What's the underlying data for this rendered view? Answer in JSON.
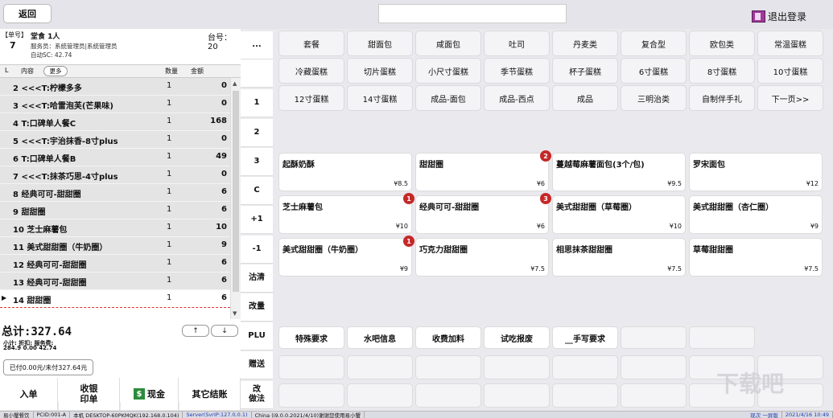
{
  "topbar": {
    "back_label": "返回",
    "logout_label": "退出登录"
  },
  "order": {
    "bill_label": "【单号】",
    "bill_no": "7",
    "dine_label": "堂食 1人",
    "staff": "服务员：系统管理员|系统管理员",
    "auto_sc": "自动SC: 42.74",
    "table_label": "台号： 20",
    "columns": {
      "idx": "L",
      "content": "内容",
      "more": "更多",
      "qty": "数量",
      "amount": "金额"
    },
    "items": [
      {
        "name": "2 <<<T:柠檬多多",
        "qty": "1",
        "amt": "0"
      },
      {
        "name": "3 <<<T:哈雷泡芙(芒果味)",
        "qty": "1",
        "amt": "0"
      },
      {
        "name": "4 T:口碑单人餐C",
        "qty": "1",
        "amt": "168"
      },
      {
        "name": "5 <<<T:宇治抹香-8寸plus",
        "qty": "1",
        "amt": "0"
      },
      {
        "name": "6 T:口碑单人餐B",
        "qty": "1",
        "amt": "49"
      },
      {
        "name": "7 <<<T:抹茶巧思-4寸plus",
        "qty": "1",
        "amt": "0"
      },
      {
        "name": "8 经典可可-甜甜圈",
        "qty": "1",
        "amt": "6"
      },
      {
        "name": "9 甜甜圈",
        "qty": "1",
        "amt": "6"
      },
      {
        "name": "10 芝士麻薯包",
        "qty": "1",
        "amt": "10"
      },
      {
        "name": "11 美式甜甜圈（牛奶圈）",
        "qty": "1",
        "amt": "9"
      },
      {
        "name": "12 经典可可-甜甜圈",
        "qty": "1",
        "amt": "6"
      },
      {
        "name": "13 经典可可-甜甜圈",
        "qty": "1",
        "amt": "6"
      },
      {
        "name": "14 甜甜圈",
        "qty": "1",
        "amt": "6"
      }
    ],
    "total": "总计:327.64",
    "up_arrow": "↑",
    "down_arrow": "↓",
    "sub_labels": "小计: 折扣: 服务费:",
    "sub_values": "284.9 0.00 42.74",
    "paid": "已付0.00元/未付327.64元",
    "buttons": {
      "enter": "入单",
      "receipt": "收银\n印单",
      "cash": "现金",
      "other": "其它结账"
    },
    "cash_icon": "dollar-icon"
  },
  "keypad": [
    "...",
    "",
    "1",
    "2",
    "3",
    "C",
    "+1",
    "-1",
    "沽清",
    "改量",
    "PLU",
    "赠送",
    "改\n做法"
  ],
  "categories": [
    [
      "套餐",
      "甜面包",
      "咸面包",
      "吐司",
      "丹麦类",
      "复合型",
      "欧包类",
      "常温蛋糕"
    ],
    [
      "冷藏蛋糕",
      "切片蛋糕",
      "小尺寸蛋糕",
      "季节蛋糕",
      "杯子蛋糕",
      "6寸蛋糕",
      "8寸蛋糕",
      "10寸蛋糕"
    ],
    [
      "12寸蛋糕",
      "14寸蛋糕",
      "成品-面包",
      "成品-西点",
      "成品",
      "三明治类",
      "自制伴手礼",
      "下一页>>"
    ]
  ],
  "products": [
    {
      "name": "起酥奶酥",
      "price": "¥8.5",
      "badge": ""
    },
    {
      "name": "甜甜圈",
      "price": "¥6",
      "badge": "2"
    },
    {
      "name": "蔓越莓麻薯面包(3个/包)",
      "price": "¥9.5",
      "badge": ""
    },
    {
      "name": "罗宋面包",
      "price": "¥12",
      "badge": ""
    },
    {
      "name": "芝士麻薯包",
      "price": "¥10",
      "badge": "1"
    },
    {
      "name": "经典可可-甜甜圈",
      "price": "¥6",
      "badge": "3"
    },
    {
      "name": "美式甜甜圈（草莓圈）",
      "price": "¥10",
      "badge": ""
    },
    {
      "name": "美式甜甜圈（杏仁圈）",
      "price": "¥9",
      "badge": ""
    },
    {
      "name": "美式甜甜圈（牛奶圈）",
      "price": "¥9",
      "badge": "1"
    },
    {
      "name": "巧克力甜甜圈",
      "price": "¥7.5",
      "badge": ""
    },
    {
      "name": "相思抹茶甜甜圈",
      "price": "¥7.5",
      "badge": ""
    },
    {
      "name": "草莓甜甜圈",
      "price": "¥7.5",
      "badge": ""
    }
  ],
  "actions": [
    "特殊要求",
    "水吧信息",
    "收费加料",
    "试吃报废",
    "__手写要求"
  ],
  "statusbar": {
    "app": "易小蟹餐饮",
    "pc": "PCID:001-A",
    "host": "本机 DESKTOP-60PKMQK(192.168.0.104)",
    "server": "Server(SvrIP:127.0.0.1)",
    "version": "China (i9.0.0.2021/4/10)谢谢您使用易小蟹",
    "user": "现次 一屏版",
    "datetime": "2021/4/16 10:49"
  },
  "watermark": "下载吧"
}
